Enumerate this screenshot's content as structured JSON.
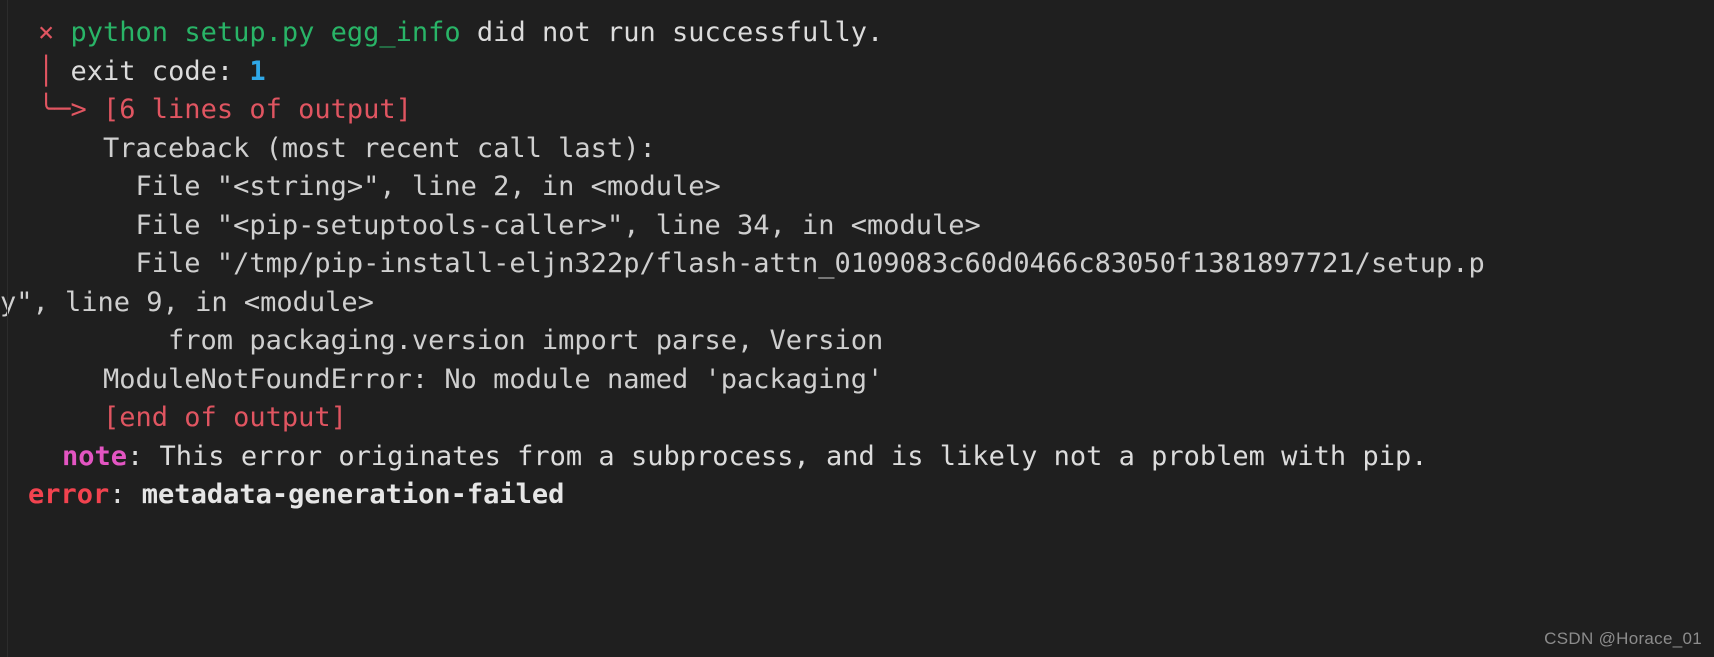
{
  "terminal": {
    "background_color": "#1f1f1f",
    "colors": {
      "red": "#e05561",
      "green": "#29b467",
      "white": "#dcdcdc",
      "blue": "#2fa8e8",
      "gray": "#cfcfcf",
      "magenta": "#e355c2",
      "error_red": "#f2434f"
    }
  },
  "output": {
    "line1": {
      "marker": "×",
      "command": "python setup.py egg_info",
      "message": " did not run successfully."
    },
    "line2": {
      "gutter": "│",
      "label": "exit code: ",
      "code": "1"
    },
    "line3": {
      "gutter": "╰─> ",
      "text": "[6 lines of output]"
    },
    "line4": "    Traceback (most recent call last):",
    "line5": "      File \"<string>\", line 2, in <module>",
    "line6": "      File \"<pip-setuptools-caller>\", line 34, in <module>",
    "line7": "      File \"/tmp/pip-install-eljn322p/flash-attn_0109083c60d0466c83050f1381897721/setup.p",
    "line8": "y\", line 9, in <module>",
    "line9": "        from packaging.version import parse, Version",
    "line10": "    ModuleNotFoundError: No module named 'packaging'",
    "line11": "    [end of output]",
    "line12": "",
    "note": {
      "label": "note",
      "text": ": This error originates from a subprocess, and is likely not a problem with pip."
    },
    "error": {
      "label": "error",
      "separator": ": ",
      "text": "metadata-generation-failed"
    }
  },
  "watermark": {
    "text": "CSDN @Horace_01"
  }
}
